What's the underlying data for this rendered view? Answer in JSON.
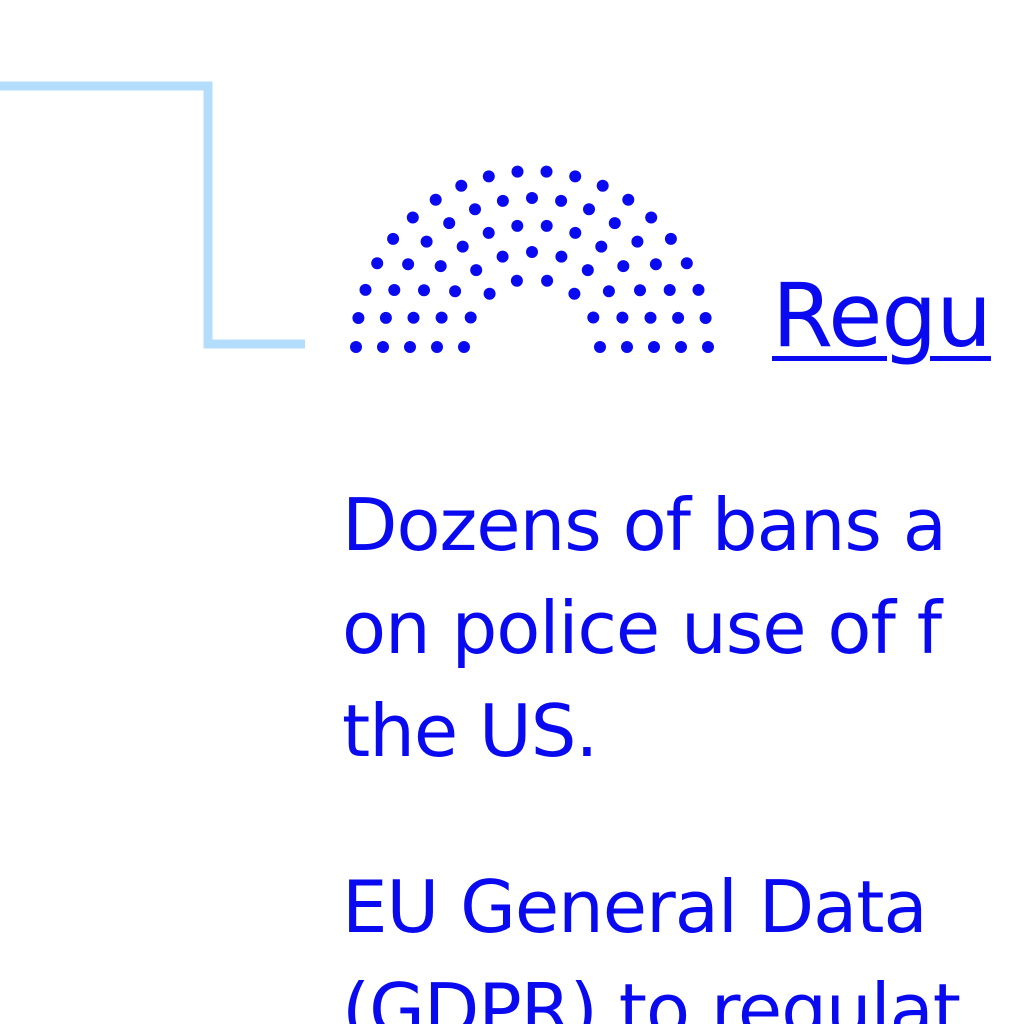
{
  "colors": {
    "primary": "#0a0af0",
    "connector": "#b4dcfb"
  },
  "icon": {
    "name": "parliament-icon"
  },
  "heading": {
    "text": "Regu"
  },
  "paragraphs": [
    {
      "lines": [
        "Dozens of bans a",
        "on police use of f",
        "the US."
      ]
    },
    {
      "lines": [
        "EU General Data",
        "(GDPR) to regulat"
      ]
    }
  ]
}
